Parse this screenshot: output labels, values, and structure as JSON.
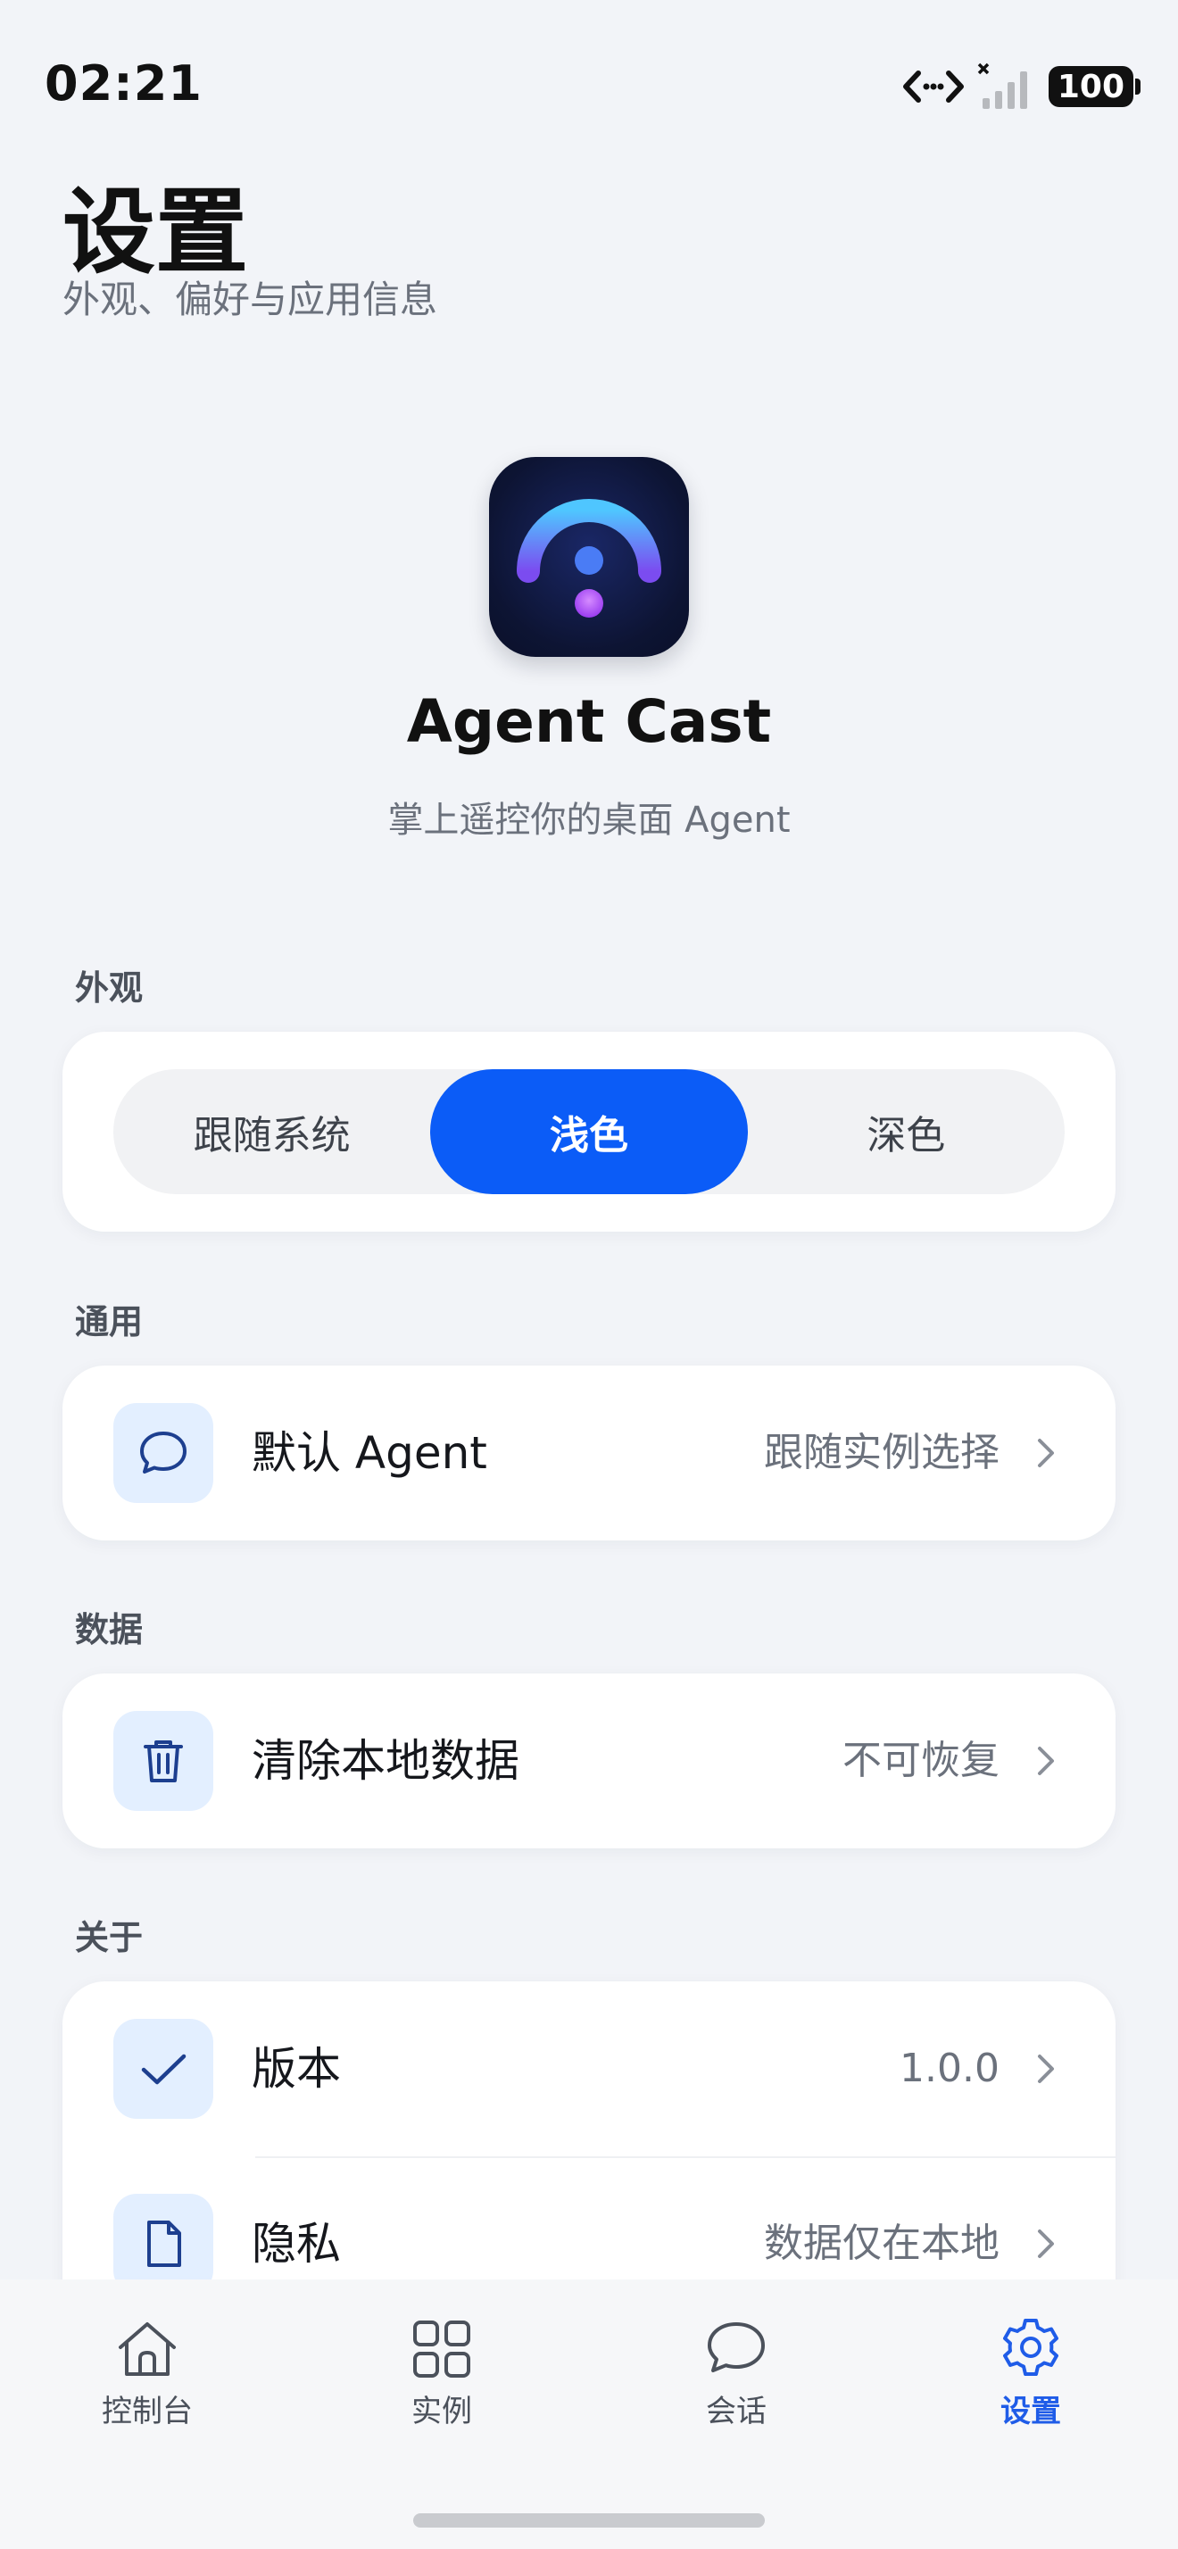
{
  "status": {
    "time": "02:21",
    "battery": "100"
  },
  "header": {
    "title": "设置",
    "subtitle": "外观、偏好与应用信息"
  },
  "app": {
    "name": "Agent Cast",
    "tagline": "掌上遥控你的桌面 Agent"
  },
  "appearance": {
    "label": "外观",
    "options": [
      "跟随系统",
      "浅色",
      "深色"
    ],
    "selected": "浅色"
  },
  "general": {
    "label": "通用",
    "default_agent": {
      "label": "默认 Agent",
      "value": "跟随实例选择",
      "icon": "chat-bubble-icon"
    }
  },
  "data_section": {
    "label": "数据",
    "clear_data": {
      "label": "清除本地数据",
      "value": "不可恢复",
      "icon": "trash-icon"
    }
  },
  "about": {
    "label": "关于",
    "version": {
      "label": "版本",
      "value": "1.0.0",
      "icon": "check-icon"
    },
    "privacy": {
      "label": "隐私",
      "value": "数据仅在本地",
      "icon": "document-icon"
    }
  },
  "nav": {
    "items": [
      {
        "label": "控制台",
        "icon": "home-icon"
      },
      {
        "label": "实例",
        "icon": "grid-icon"
      },
      {
        "label": "会话",
        "icon": "chat-icon"
      },
      {
        "label": "设置",
        "icon": "gear-icon"
      }
    ],
    "active": "设置"
  },
  "colors": {
    "accent": "#0b5cf7",
    "icon_bg": "#e3efff",
    "icon_stroke": "#1d3f8f",
    "background": "#f2f4f8"
  }
}
